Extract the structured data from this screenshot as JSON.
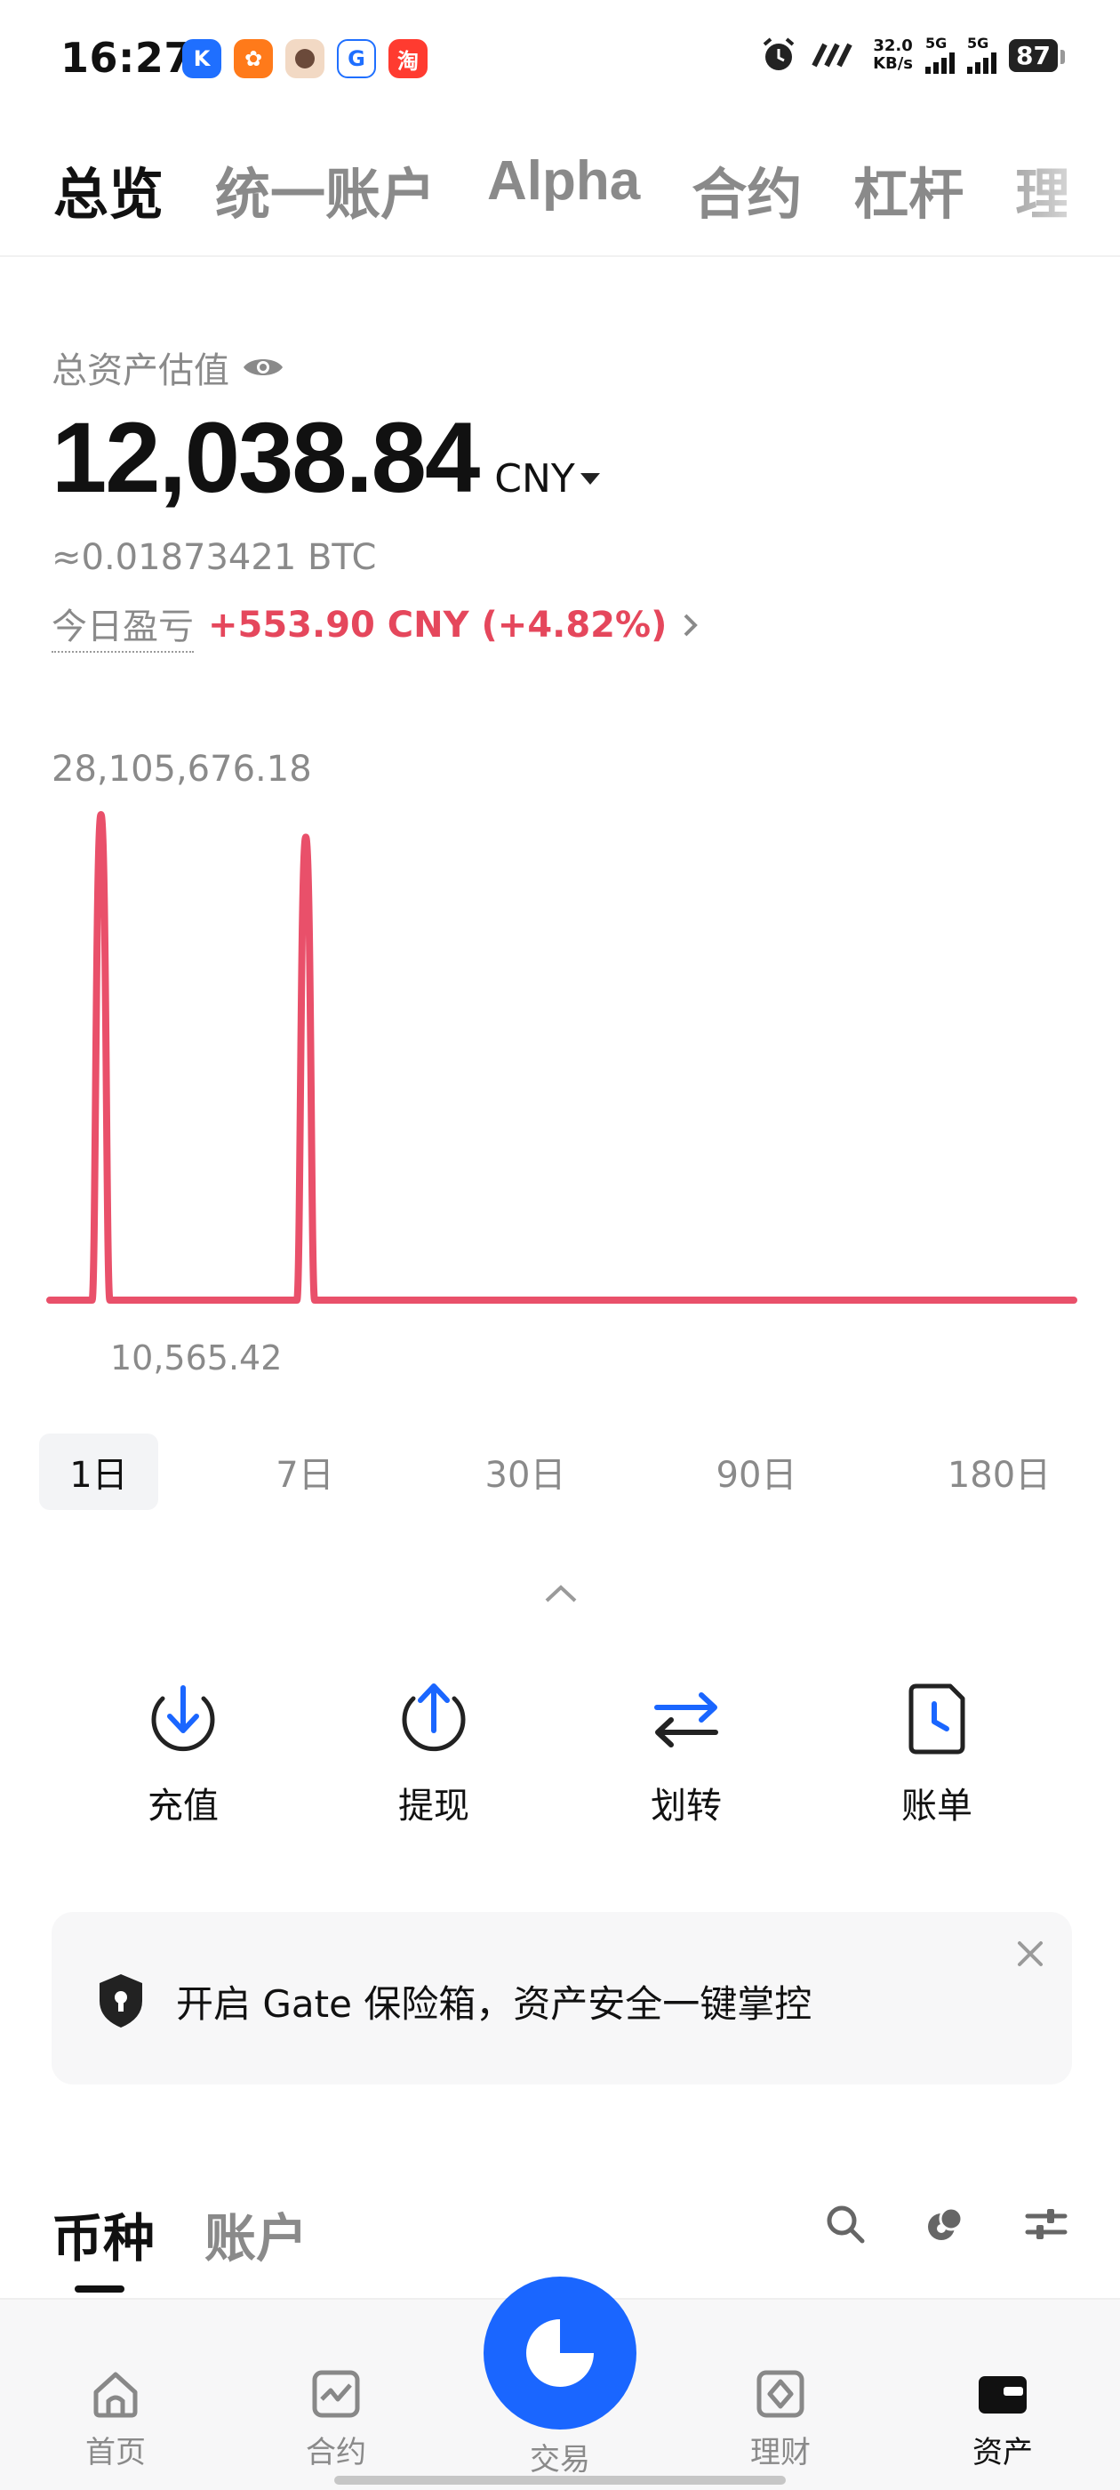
{
  "status_bar": {
    "time": "16:27",
    "speed_value": "32.0",
    "speed_unit": "KB/s",
    "signal1_label": "5G",
    "signal2_label": "5G",
    "battery": "87",
    "app_icons": [
      "kuai-icon",
      "ant-icon",
      "avatar-icon",
      "gate-app-icon",
      "taobao-icon"
    ]
  },
  "top_tabs": [
    {
      "label": "总览",
      "active": true
    },
    {
      "label": "统一账户"
    },
    {
      "label": "Alpha"
    },
    {
      "label": "合约"
    },
    {
      "label": "杠杆"
    },
    {
      "label": "理"
    }
  ],
  "overview": {
    "total_label": "总资产估值",
    "balance": "12,038.84",
    "currency": "CNY",
    "btc_equiv": "≈0.01873421 BTC",
    "pnl_label": "今日盈亏",
    "pnl_value": "+553.90 CNY (+4.82%)"
  },
  "chart_data": {
    "type": "line",
    "max_label": "28,105,676.18",
    "min_label": "10,565.42",
    "color": "#e9506a",
    "ylim": [
      10565.42,
      28105676.18
    ],
    "x": [
      0,
      1,
      2,
      3,
      4,
      5,
      6,
      7,
      8,
      9,
      10,
      11,
      12,
      13,
      14,
      15,
      16,
      17,
      18,
      19,
      20
    ],
    "values": [
      10565.42,
      28105676.18,
      10565.42,
      10565.42,
      10565.42,
      26800000,
      10565.42,
      10565.42,
      10565.42,
      10565.42,
      10565.42,
      10565.42,
      10565.42,
      10565.42,
      10565.42,
      10565.42,
      10565.42,
      10565.42,
      10565.42,
      10565.42,
      10565.42
    ]
  },
  "ranges": [
    {
      "label": "1日",
      "active": true
    },
    {
      "label": "7日"
    },
    {
      "label": "30日"
    },
    {
      "label": "90日"
    },
    {
      "label": "180日"
    }
  ],
  "actions": [
    {
      "label": "充值",
      "icon": "deposit-icon"
    },
    {
      "label": "提现",
      "icon": "withdraw-icon"
    },
    {
      "label": "划转",
      "icon": "transfer-icon"
    },
    {
      "label": "账单",
      "icon": "bill-icon"
    }
  ],
  "banner": {
    "text": "开启 Gate 保险箱，资产安全一键掌控"
  },
  "section_tabs": [
    {
      "label": "币种",
      "active": true
    },
    {
      "label": "账户"
    }
  ],
  "bottom_nav": [
    {
      "label": "首页",
      "icon": "home-icon"
    },
    {
      "label": "合约",
      "icon": "futures-icon"
    },
    {
      "label": "交易",
      "icon": "trade-icon"
    },
    {
      "label": "理财",
      "icon": "earn-icon"
    },
    {
      "label": "资产",
      "icon": "wallet-icon",
      "active": true
    }
  ]
}
